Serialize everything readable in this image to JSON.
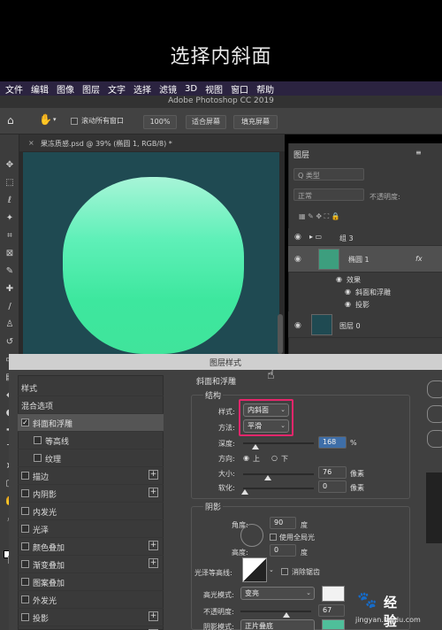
{
  "caption": "选择内斜面",
  "menubar": [
    "文件",
    "编辑",
    "图像",
    "图层",
    "文字",
    "选择",
    "滤镜",
    "3D",
    "视图",
    "窗口",
    "帮助"
  ],
  "app_title": "Adobe Photoshop CC 2019",
  "options": {
    "scroll_all": "滚动所有窗口",
    "zoom": "100%",
    "fit_screen": "适合屏幕",
    "fill_screen": "填充屏幕"
  },
  "doc_tab": "果冻质感.psd @ 39% (椭圆 1, RGB/8) *",
  "layers_panel": {
    "tab": "图层",
    "kind_placeholder": "Q 类型",
    "blend_mode": "正常",
    "opacity_label": "不透明度:",
    "group": "组 3",
    "layer_name": "椭圆 1",
    "fx": "fx",
    "effects_label": "效果",
    "effect1": "斜面和浮雕",
    "effect2": "投影",
    "bg_layer": "图层 0"
  },
  "dialog": {
    "title": "图层样式",
    "list": [
      {
        "label": "样式",
        "checkbox": false,
        "checked": false,
        "plus": false,
        "indent": false
      },
      {
        "label": "混合选项",
        "checkbox": false,
        "checked": false,
        "plus": false,
        "indent": false
      },
      {
        "label": "斜面和浮雕",
        "checkbox": true,
        "checked": true,
        "plus": false,
        "indent": false,
        "selected": true
      },
      {
        "label": "等高线",
        "checkbox": true,
        "checked": false,
        "plus": false,
        "indent": true
      },
      {
        "label": "纹理",
        "checkbox": true,
        "checked": false,
        "plus": false,
        "indent": true
      },
      {
        "label": "描边",
        "checkbox": true,
        "checked": false,
        "plus": true,
        "indent": false
      },
      {
        "label": "内阴影",
        "checkbox": true,
        "checked": false,
        "plus": true,
        "indent": false
      },
      {
        "label": "内发光",
        "checkbox": true,
        "checked": false,
        "plus": false,
        "indent": false
      },
      {
        "label": "光泽",
        "checkbox": true,
        "checked": false,
        "plus": false,
        "indent": false
      },
      {
        "label": "颜色叠加",
        "checkbox": true,
        "checked": false,
        "plus": true,
        "indent": false
      },
      {
        "label": "渐变叠加",
        "checkbox": true,
        "checked": false,
        "plus": true,
        "indent": false
      },
      {
        "label": "图案叠加",
        "checkbox": true,
        "checked": false,
        "plus": false,
        "indent": false
      },
      {
        "label": "外发光",
        "checkbox": true,
        "checked": false,
        "plus": false,
        "indent": false
      },
      {
        "label": "投影",
        "checkbox": true,
        "checked": false,
        "plus": true,
        "indent": false
      },
      {
        "label": "投影",
        "checkbox": true,
        "checked": true,
        "plus": true,
        "indent": false
      }
    ],
    "bevel_title": "斜面和浮雕",
    "structure_title": "结构",
    "style_label": "样式:",
    "style_value": "内斜面",
    "technique_label": "方法:",
    "technique_value": "平滑",
    "depth_label": "深度:",
    "depth_value": "168",
    "depth_unit": "%",
    "direction_label": "方向:",
    "direction_up": "上",
    "direction_down": "下",
    "size_label": "大小:",
    "size_value": "76",
    "size_unit": "像素",
    "soften_label": "软化:",
    "soften_value": "0",
    "soften_unit": "像素",
    "shading_title": "阴影",
    "angle_label": "角度:",
    "angle_value": "90",
    "angle_unit": "度",
    "global_light": "使用全局光",
    "altitude_label": "高度:",
    "altitude_value": "0",
    "altitude_unit": "度",
    "gloss_label": "光泽等高线:",
    "antialias": "消除锯齿",
    "highlight_label": "高光模式:",
    "highlight_value": "变亮",
    "opacity_label": "不透明度:",
    "opacity_value": "67",
    "shadow_label": "阴影模式:",
    "shadow_value": "正片叠底"
  },
  "watermark": {
    "logo": "Bai",
    "text": "经验",
    "url": "jingyan.baidu.com"
  },
  "colors": {
    "accent_highlight": "#e6266b",
    "canvas_bg": "#1f4a52",
    "shape_green": "#40e49b"
  }
}
